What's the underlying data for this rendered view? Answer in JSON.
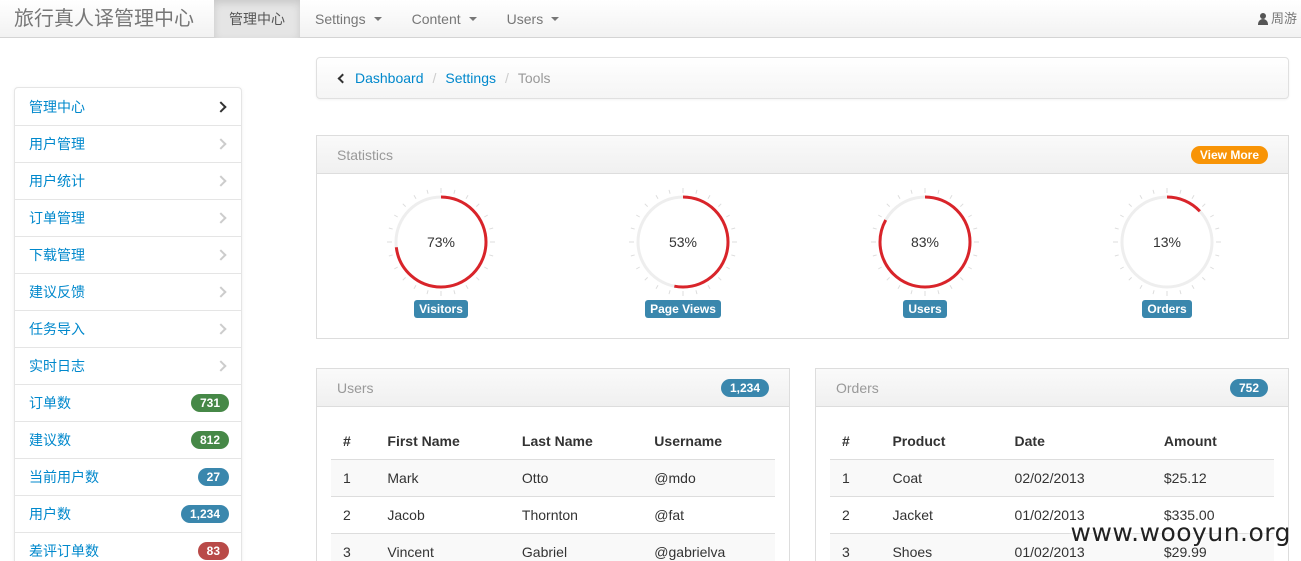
{
  "nav": {
    "brand": "旅行真人译管理中心",
    "items": [
      {
        "label": "管理中心",
        "active": true,
        "dropdown": false
      },
      {
        "label": "Settings",
        "active": false,
        "dropdown": true
      },
      {
        "label": "Content",
        "active": false,
        "dropdown": true
      },
      {
        "label": "Users",
        "active": false,
        "dropdown": true
      }
    ],
    "user": "周游"
  },
  "sidebar": {
    "items": [
      {
        "label": "管理中心",
        "type": "chevron",
        "current": true
      },
      {
        "label": "用户管理",
        "type": "chevron"
      },
      {
        "label": "用户统计",
        "type": "chevron"
      },
      {
        "label": "订单管理",
        "type": "chevron"
      },
      {
        "label": "下载管理",
        "type": "chevron"
      },
      {
        "label": "建议反馈",
        "type": "chevron"
      },
      {
        "label": "任务导入",
        "type": "chevron"
      },
      {
        "label": "实时日志",
        "type": "chevron"
      },
      {
        "label": "订单数",
        "type": "badge",
        "badge": "731",
        "badge_color": "#468847"
      },
      {
        "label": "建议数",
        "type": "badge",
        "badge": "812",
        "badge_color": "#468847"
      },
      {
        "label": "当前用户数",
        "type": "badge",
        "badge": "27",
        "badge_color": "#3a87ad"
      },
      {
        "label": "用户数",
        "type": "badge",
        "badge": "1,234",
        "badge_color": "#3a87ad"
      },
      {
        "label": "差评订单数",
        "type": "badge",
        "badge": "83",
        "badge_color": "#b94a48"
      }
    ]
  },
  "breadcrumb": {
    "links": [
      "Dashboard",
      "Settings"
    ],
    "current": "Tools"
  },
  "statistics": {
    "title": "Statistics",
    "view_more": "View More",
    "gauges": [
      {
        "label": "Visitors",
        "percent": 73,
        "text": "73%"
      },
      {
        "label": "Page Views",
        "percent": 53,
        "text": "53%"
      },
      {
        "label": "Users",
        "percent": 83,
        "text": "83%"
      },
      {
        "label": "Orders",
        "percent": 13,
        "text": "13%"
      }
    ],
    "gauge_color": "#d9242a"
  },
  "users_table": {
    "title": "Users",
    "badge": "1,234",
    "columns": [
      "#",
      "First Name",
      "Last Name",
      "Username"
    ],
    "rows": [
      [
        "1",
        "Mark",
        "Otto",
        "@mdo"
      ],
      [
        "2",
        "Jacob",
        "Thornton",
        "@fat"
      ],
      [
        "3",
        "Vincent",
        "Gabriel",
        "@gabrielva"
      ]
    ]
  },
  "orders_table": {
    "title": "Orders",
    "badge": "752",
    "columns": [
      "#",
      "Product",
      "Date",
      "Amount"
    ],
    "rows": [
      [
        "1",
        "Coat",
        "02/02/2013",
        "$25.12"
      ],
      [
        "2",
        "Jacket",
        "01/02/2013",
        "$335.00"
      ],
      [
        "3",
        "Shoes",
        "01/02/2013",
        "$29.99"
      ]
    ]
  },
  "watermark": "www.wooyun.org"
}
